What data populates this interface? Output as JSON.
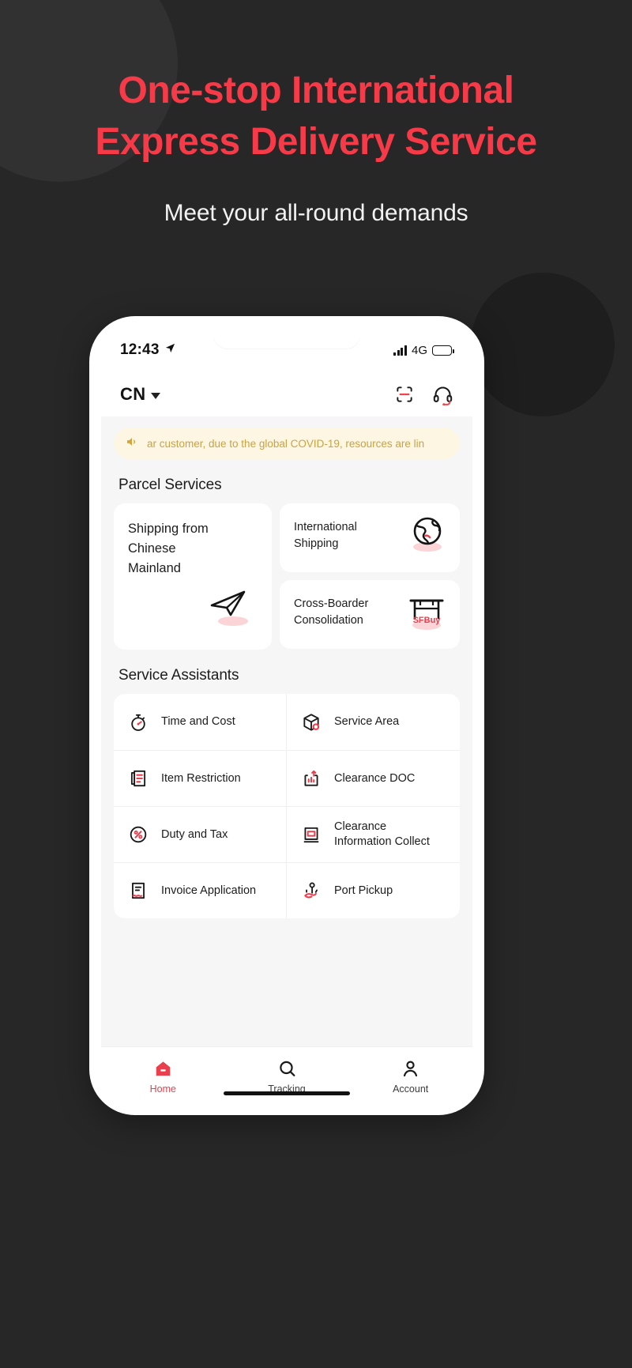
{
  "hero": {
    "title_line1": "One-stop International",
    "title_line2": "Express Delivery Service",
    "subtitle": "Meet your all-round demands",
    "title_color": "#f63a48",
    "subtitle_color": "#f2f2f2",
    "background_color": "#272727"
  },
  "statusbar": {
    "time": "12:43",
    "location_icon": "location-arrow-icon",
    "signal_icon": "signal-bars-icon",
    "network": "4G",
    "battery_icon": "battery-icon"
  },
  "appheader": {
    "region": "CN",
    "region_caret": "chevron-down-icon",
    "scan_icon": "scan-icon",
    "support_icon": "headset-icon"
  },
  "notice": {
    "speaker_icon": "speaker-icon",
    "text": "ar customer, due to the global COVID-19, resources are lin",
    "text_color": "#caa33f",
    "background_color": "#fdf6e3"
  },
  "parcel_services": {
    "section_title": "Parcel Services",
    "cards": [
      {
        "title": "Shipping from\nChinese\nMainland",
        "icon": "paper-plane-icon",
        "size": "large"
      },
      {
        "title": "International\nShipping",
        "icon": "globe-icon",
        "size": "small"
      },
      {
        "title": "Cross-Boarder\nConsolidation",
        "icon": "storefront-sfbuy-icon",
        "size": "small",
        "icon_label": "SFBuy"
      }
    ]
  },
  "service_assistants": {
    "section_title": "Service Assistants",
    "items": [
      {
        "label": "Time and Cost",
        "icon": "stopwatch-icon"
      },
      {
        "label": "Service Area",
        "icon": "box-location-icon"
      },
      {
        "label": "Item Restriction",
        "icon": "document-list-icon"
      },
      {
        "label": "Clearance DOC",
        "icon": "chart-upload-icon"
      },
      {
        "label": "Duty and Tax",
        "icon": "percent-circle-icon"
      },
      {
        "label": "Clearance\nInformation Collect",
        "icon": "document-collect-icon"
      },
      {
        "label": "Invoice Application",
        "icon": "invoice-icon"
      },
      {
        "label": "Port Pickup",
        "icon": "pin-hand-icon"
      }
    ]
  },
  "tabbar": {
    "tabs": [
      {
        "label": "Home",
        "icon": "home-icon",
        "active": true
      },
      {
        "label": "Tracking",
        "icon": "search-icon",
        "active": false
      },
      {
        "label": "Account",
        "icon": "person-icon",
        "active": false
      }
    ],
    "active_color": "#e8404c",
    "inactive_color": "#3b3b3b"
  }
}
